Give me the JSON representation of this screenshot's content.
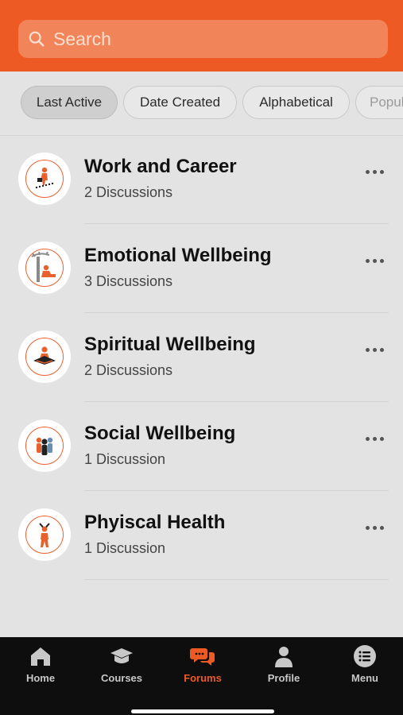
{
  "search": {
    "placeholder": "Search"
  },
  "filters": [
    {
      "label": "Last Active",
      "active": true
    },
    {
      "label": "Date Created",
      "active": false
    },
    {
      "label": "Alphabetical",
      "active": false
    },
    {
      "label": "Popular",
      "active": false
    }
  ],
  "forums": [
    {
      "title": "Work and Career",
      "count": "2 Discussions",
      "icon": "career-stairs-icon"
    },
    {
      "title": "Emotional Wellbeing",
      "count": "3 Discussions",
      "icon": "tree-rest-icon"
    },
    {
      "title": "Spiritual Wellbeing",
      "count": "2 Discussions",
      "icon": "meditation-icon"
    },
    {
      "title": "Social Wellbeing",
      "count": "1 Discussion",
      "icon": "people-group-icon"
    },
    {
      "title": "Phyiscal Health",
      "count": "1 Discussion",
      "icon": "stretching-person-icon"
    }
  ],
  "tabs": [
    {
      "label": "Home",
      "icon": "home-icon",
      "active": false
    },
    {
      "label": "Courses",
      "icon": "graduation-cap-icon",
      "active": false
    },
    {
      "label": "Forums",
      "icon": "chat-bubbles-icon",
      "active": true
    },
    {
      "label": "Profile",
      "icon": "person-icon",
      "active": false
    },
    {
      "label": "Menu",
      "icon": "list-icon",
      "active": false
    }
  ],
  "colors": {
    "accent": "#ee5a24",
    "background": "#e3e3e3",
    "tabbar": "#0e0e0e"
  }
}
